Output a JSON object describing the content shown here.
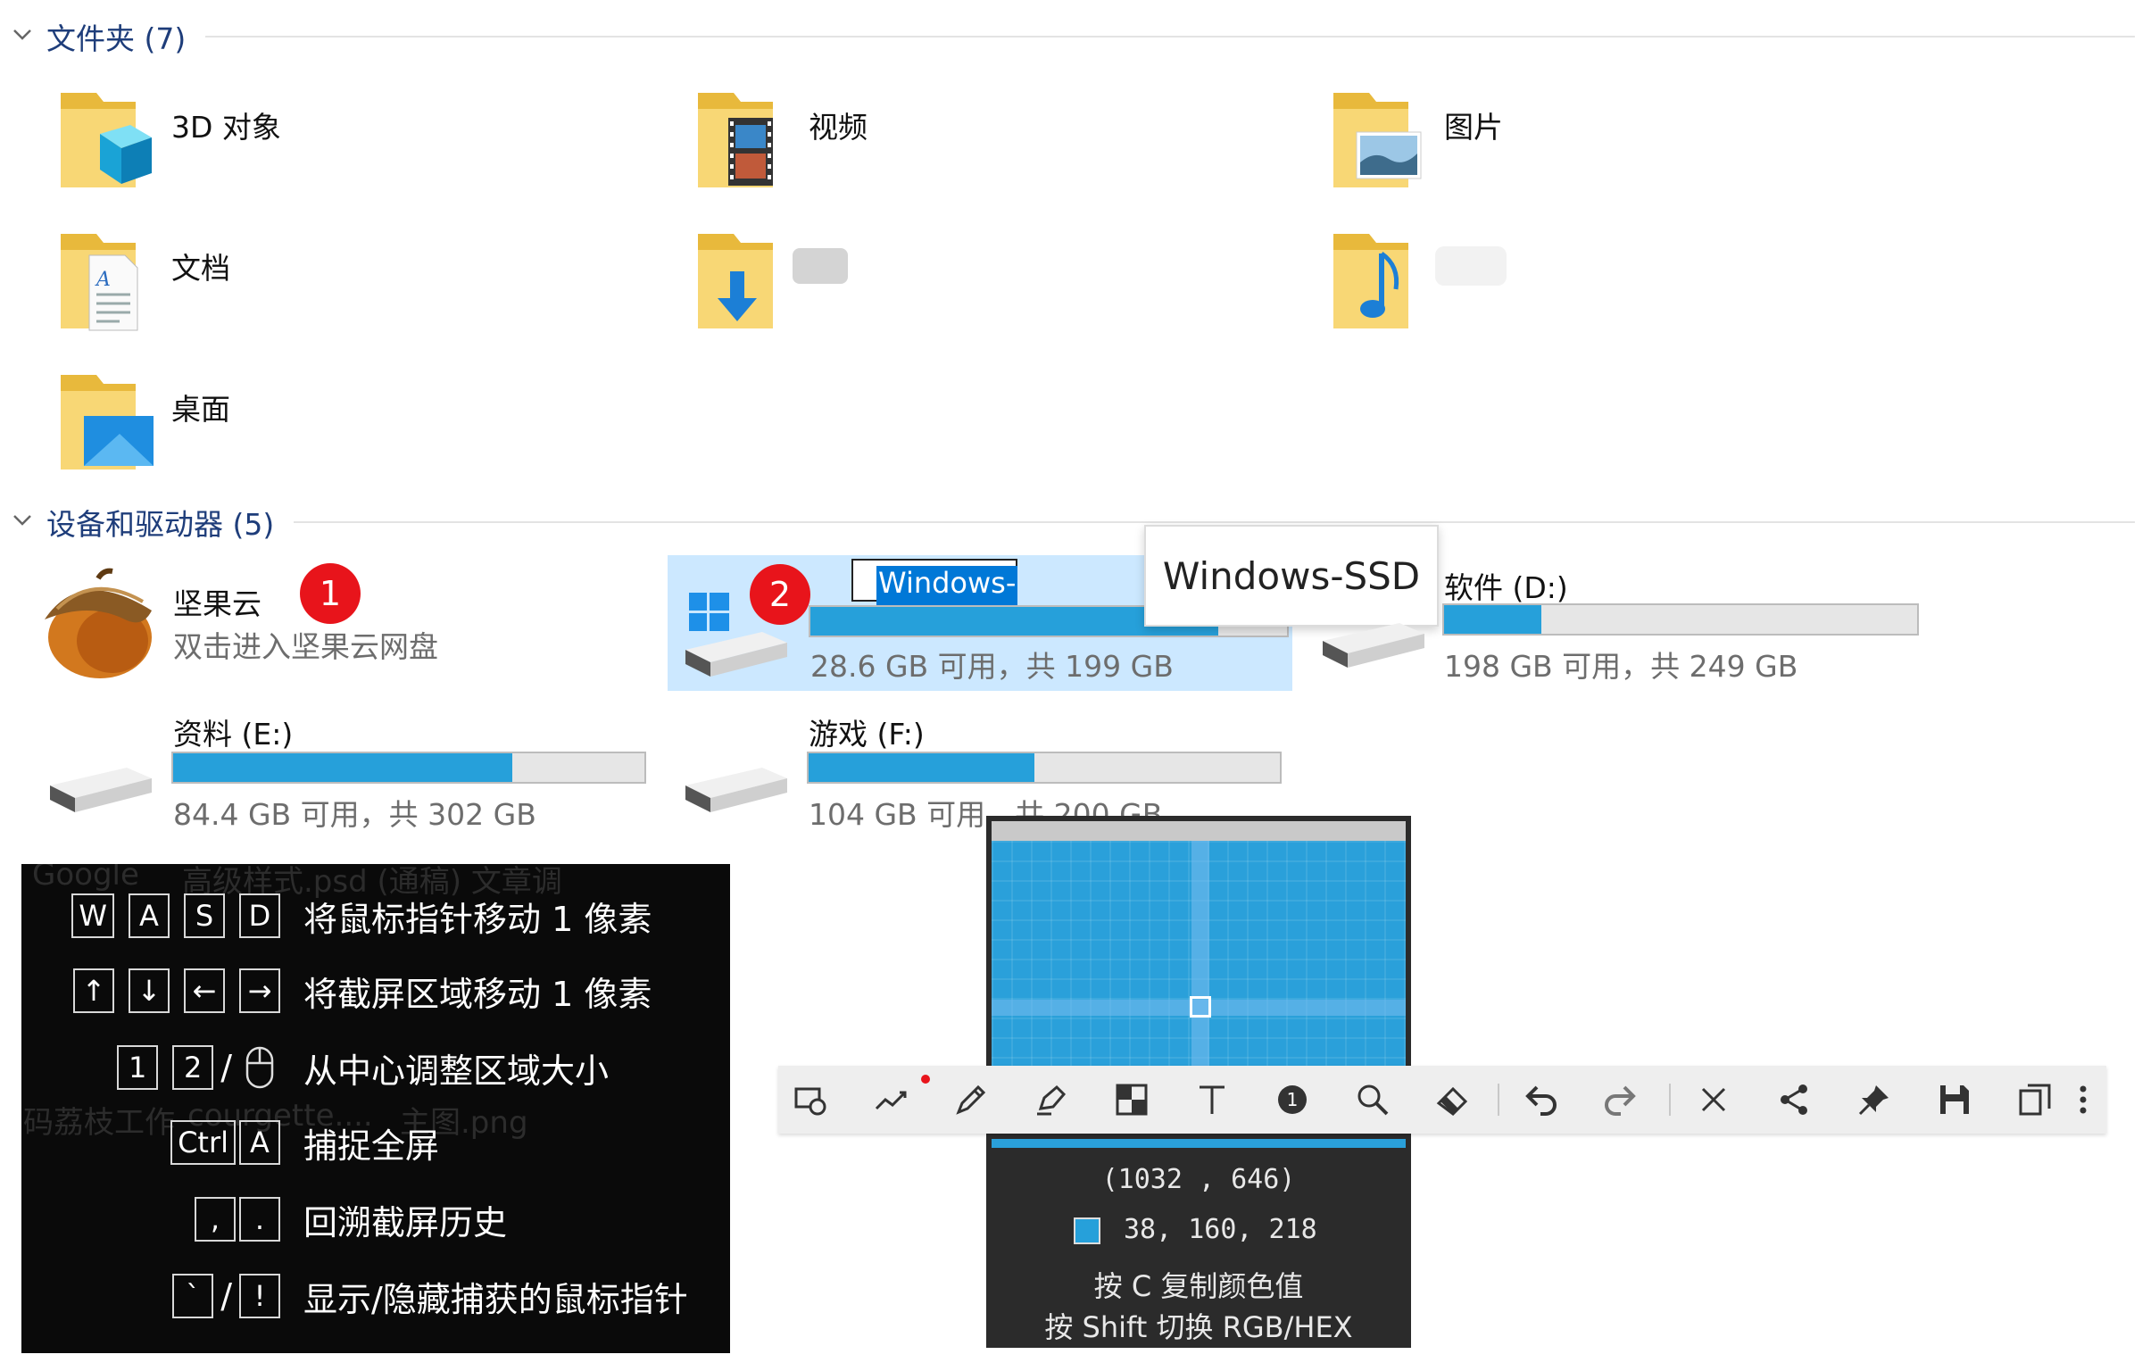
{
  "groups": {
    "folders": {
      "title": "文件夹 (7)"
    },
    "devices": {
      "title": "设备和驱动器 (5)"
    }
  },
  "folders": [
    {
      "label": "3D 对象",
      "icon": "3d-objects-folder-icon"
    },
    {
      "label": "视频",
      "icon": "videos-folder-icon"
    },
    {
      "label": "图片",
      "icon": "pictures-folder-icon"
    },
    {
      "label": "文档",
      "icon": "documents-folder-icon"
    },
    {
      "label": "",
      "icon": "downloads-folder-icon"
    },
    {
      "label": "",
      "icon": "music-folder-icon"
    },
    {
      "label": "桌面",
      "icon": "desktop-folder-icon"
    }
  ],
  "jianguoyun": {
    "name": "坚果云",
    "subtitle": "双击进入坚果云网盘",
    "badge": "1"
  },
  "drives": {
    "c": {
      "rename_value": "Windows-SSD",
      "free_text": "28.6 GB 可用，共 199 GB",
      "badge": "2",
      "used_fraction": 0.856
    },
    "d": {
      "name": "软件 (D:)",
      "free_text": "198 GB 可用，共 249 GB",
      "used_fraction": 0.205
    },
    "e": {
      "name": "资料 (E:)",
      "free_text": "84.4 GB 可用，共 302 GB",
      "used_fraction": 0.72
    },
    "f": {
      "name": "游戏 (F:)",
      "free_text": "104 GB 可用，共 200 GB",
      "used_fraction": 0.48
    }
  },
  "tooltip": {
    "text": "Windows-SSD"
  },
  "shortcuts": {
    "ghost_texts": [
      "Google",
      "高级样式.psd (通稿) 文章调",
      "码荔枝工作",
      "courgette....",
      "主图.png"
    ],
    "rows": [
      {
        "keys": [
          "W",
          "A",
          "S",
          "D"
        ],
        "desc": "将鼠标指针移动 1 像素"
      },
      {
        "keys": [
          "↑",
          "↓",
          "←",
          "→"
        ],
        "desc": "将截屏区域移动 1 像素"
      },
      {
        "keys": [
          "1",
          "2"
        ],
        "sep": "/",
        "mouse": true,
        "desc": "从中心调整区域大小"
      },
      {
        "keys": [
          "Ctrl",
          "A"
        ],
        "desc": "捕捉全屏"
      },
      {
        "keys": [
          ",",
          "."
        ],
        "desc": "回溯截屏历史"
      },
      {
        "keys": [
          "`"
        ],
        "sep": "/",
        "keys2": [
          "!"
        ],
        "desc": "显示/隐藏捕获的鼠标指针"
      }
    ]
  },
  "magnifier": {
    "coords": "(1032 , 646)",
    "rgb": "38, 160, 218",
    "swatch_color": "#26a0da",
    "hint1": "按 C 复制颜色值",
    "hint2": "按 Shift 切换 RGB/HEX"
  },
  "toolbar": {
    "tools": [
      "shape-icon",
      "line-icon",
      "pen-icon",
      "highlighter-icon",
      "mosaic-icon",
      "text-icon",
      "number-icon",
      "magnifier-icon",
      "eraser-icon",
      "undo-icon",
      "redo-icon",
      "close-icon",
      "share-icon",
      "pin-icon",
      "save-icon",
      "copy-icon",
      "more-icon"
    ]
  },
  "colors": {
    "accent": "#26a0da",
    "badge": "#e8141b",
    "selection": "#cce8ff"
  }
}
